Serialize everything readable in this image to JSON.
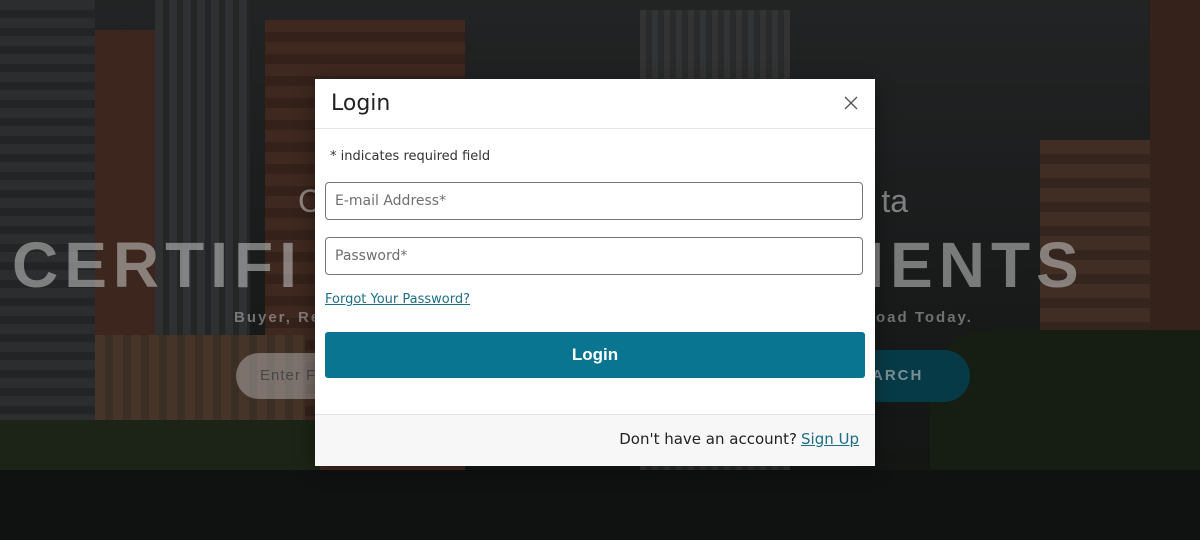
{
  "background": {
    "hero_subtitle_left": "C",
    "hero_subtitle_right": "ta",
    "hero_title": "CERTIFI                    UMENTS",
    "hero_tag_left": "Buyer, Re",
    "hero_tag_right": "oad Today.",
    "search_placeholder": "Enter F",
    "search_button_label": "ARCH"
  },
  "modal": {
    "title": "Login",
    "close_icon": "close-icon",
    "required_note": "* indicates required field",
    "email_placeholder": "E-mail Address*",
    "password_placeholder": "Password*",
    "forgot_link": "Forgot Your Password?",
    "login_button": "Login",
    "footer_prompt": "Don't have an account?",
    "signup_link": "Sign Up"
  },
  "colors": {
    "primary_button": "#0a7590",
    "link": "#1d6f86"
  }
}
